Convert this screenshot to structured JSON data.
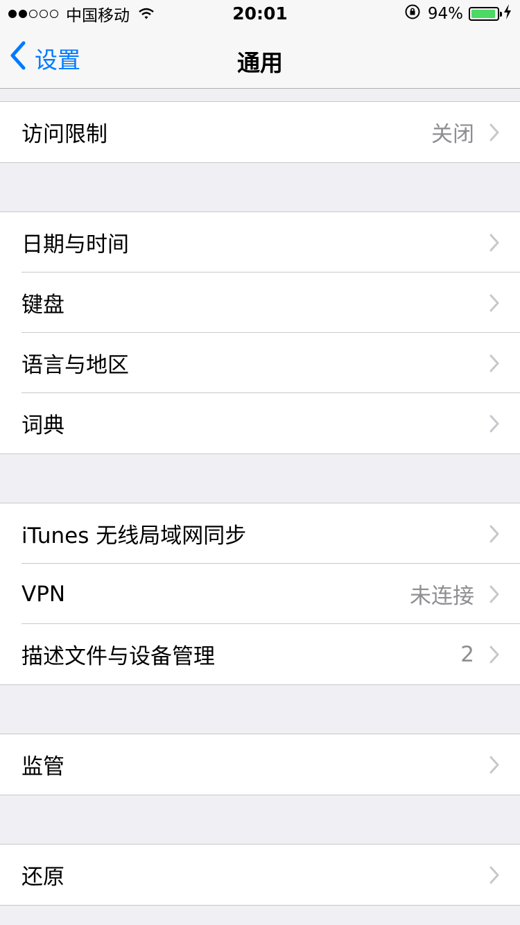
{
  "status_bar": {
    "carrier": "中国移动",
    "time": "20:01",
    "battery_percent": "94%",
    "battery_level": 0.94,
    "signal_bars_filled": 2,
    "signal_bars_total": 5
  },
  "nav": {
    "back_label": "设置",
    "title": "通用"
  },
  "groups": [
    {
      "rows": [
        {
          "label": "访问限制",
          "value": "关闭"
        }
      ]
    },
    {
      "rows": [
        {
          "label": "日期与时间",
          "value": ""
        },
        {
          "label": "键盘",
          "value": ""
        },
        {
          "label": "语言与地区",
          "value": ""
        },
        {
          "label": "词典",
          "value": ""
        }
      ]
    },
    {
      "rows": [
        {
          "label": "iTunes 无线局域网同步",
          "value": ""
        },
        {
          "label": "VPN",
          "value": "未连接"
        },
        {
          "label": "描述文件与设备管理",
          "value": "2"
        }
      ]
    },
    {
      "rows": [
        {
          "label": "监管",
          "value": ""
        }
      ]
    },
    {
      "rows": [
        {
          "label": "还原",
          "value": ""
        }
      ]
    }
  ],
  "colors": {
    "accent": "#007aff",
    "battery": "#4cd964",
    "secondary_text": "#8e8e93",
    "background": "#efeff4"
  },
  "icons": [
    "wifi-icon",
    "rotation-lock-icon",
    "battery-icon",
    "charging-bolt-icon",
    "back-chevron-icon",
    "chevron-right-icon"
  ]
}
